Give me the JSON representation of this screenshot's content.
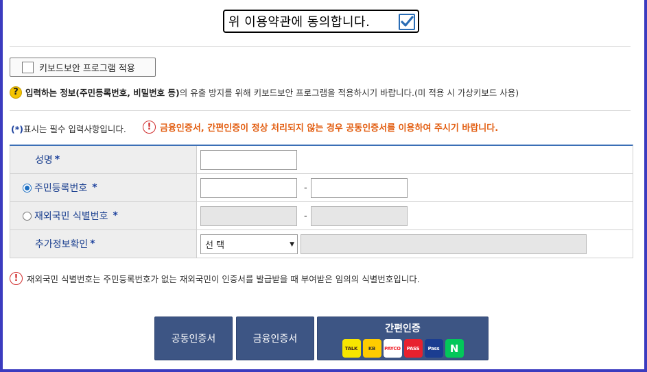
{
  "agreement": {
    "label": "위 이용약관에 동의합니다.",
    "checked": true,
    "check_color": "#2a6db5"
  },
  "keyboard_security": {
    "button_label": "키보드보안 프로그램 적용",
    "checked": false,
    "info_icon": "question-icon",
    "info_bold": "입력하는 정보(주민등록번호, 비밀번호 등)",
    "info_rest": "의 유출 방지를 위해 키보드보안 프로그램을 적용하시기 바랍니다.(미 적용 시 가상키보드 사용)"
  },
  "notices": {
    "required_star": "(*)",
    "required_text": "표시는 필수 입력사항입니다.",
    "warning_icon": "exclamation-icon",
    "warning_text": "금융인증서, 간편인증이 정상 처리되지 않는 경우 공동인증서를 이용하여 주시기 바랍니다.",
    "warning_color": "#e25d10",
    "foreign_note": "재외국민 식별번호는 주민등록번호가 없는 재외국민이 인증서를 발급받을 때 부여받은 임의의 식별번호입니다."
  },
  "form": {
    "rows": [
      {
        "label": "성명",
        "required": "*",
        "value": ""
      },
      {
        "label": "주민등록번호",
        "required": "*",
        "radio_selected": true,
        "value1": "",
        "value2": "",
        "separator": "-"
      },
      {
        "label": "재외국민 식별번호",
        "required": "*",
        "radio_selected": false,
        "value1": "",
        "value2": "",
        "separator": "-",
        "disabled": true
      },
      {
        "label": "추가정보확인",
        "required": "*",
        "select_value": "선 택",
        "extra_value": ""
      }
    ],
    "header_color": "#1a3f8f"
  },
  "buttons": {
    "joint_cert": "공동인증서",
    "financial_cert": "금융인증서",
    "simple_auth": "간편인증",
    "button_color": "#3d5584",
    "simple_auth_services": [
      {
        "name": "TALK",
        "icon": "kakaotalk-icon",
        "bg": "#f7e600",
        "fg": "#3a1d1d"
      },
      {
        "name": "KB",
        "icon": "kb-icon",
        "bg": "#ffcc00",
        "fg": "#333333"
      },
      {
        "name": "PAYCO",
        "icon": "payco-icon",
        "bg": "#ffffff",
        "fg": "#ef1c25"
      },
      {
        "name": "PASS",
        "icon": "pass-icon",
        "bg": "#e8212e",
        "fg": "#ffffff"
      },
      {
        "name": "Pass",
        "icon": "samsung-pass-icon",
        "bg": "#1b3d91",
        "fg": "#ffffff"
      },
      {
        "name": "N",
        "icon": "naver-icon",
        "bg": "#03c75a",
        "fg": "#ffffff"
      }
    ]
  }
}
